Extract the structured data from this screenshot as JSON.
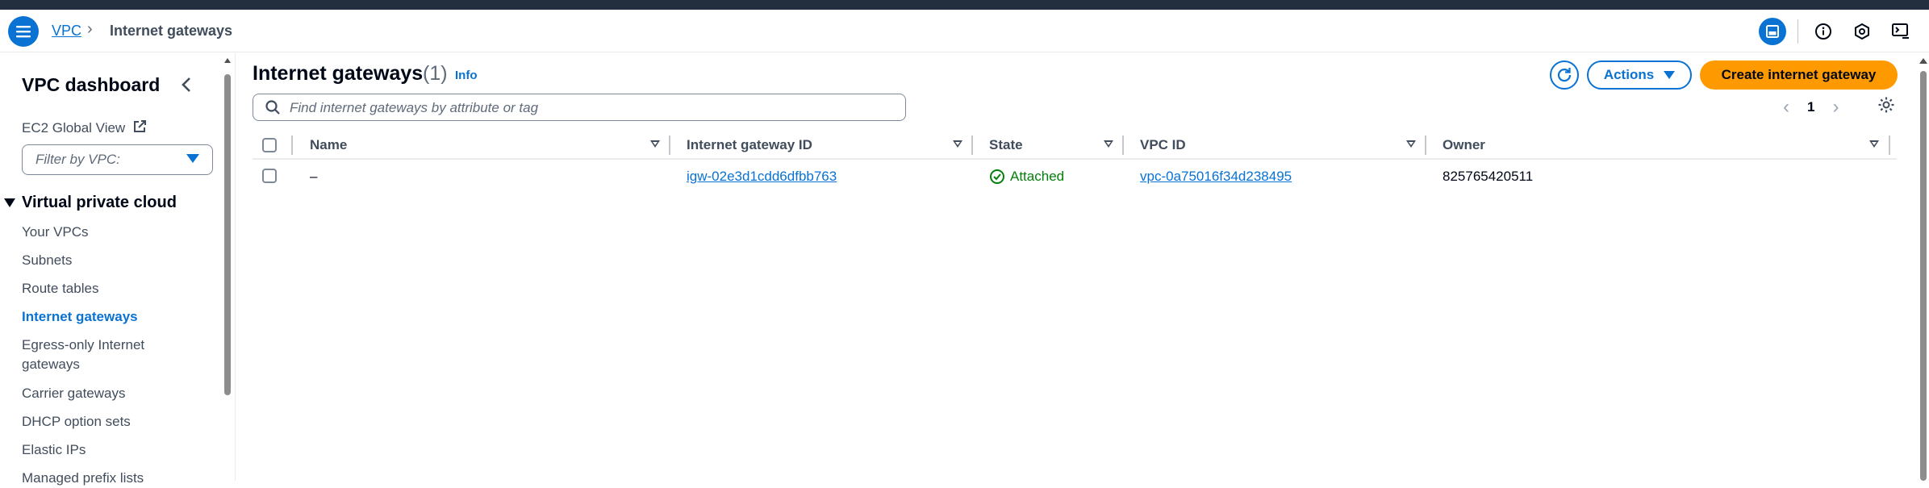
{
  "breadcrumb": {
    "root": "VPC",
    "separator": "›",
    "current": "Internet gateways"
  },
  "sidebar": {
    "title": "VPC dashboard",
    "ec2_global_view": "EC2 Global View",
    "filter_placeholder": "Filter by VPC:",
    "section": "Virtual private cloud",
    "items": [
      {
        "label": "Your VPCs"
      },
      {
        "label": "Subnets"
      },
      {
        "label": "Route tables"
      },
      {
        "label": "Internet gateways"
      },
      {
        "label": "Egress-only Internet gateways"
      },
      {
        "label": "Carrier gateways"
      },
      {
        "label": "DHCP option sets"
      },
      {
        "label": "Elastic IPs"
      },
      {
        "label": "Managed prefix lists"
      }
    ]
  },
  "main": {
    "title": "Internet gateways",
    "count": "(1)",
    "info": "Info",
    "actions_label": "Actions",
    "create_label": "Create internet gateway",
    "search_placeholder": "Find internet gateways by attribute or tag",
    "page": "1",
    "prev": "‹",
    "next": "›"
  },
  "table": {
    "columns": [
      "Name",
      "Internet gateway ID",
      "State",
      "VPC ID",
      "Owner"
    ],
    "rows": [
      {
        "name": "–",
        "igw_id": "igw-02e3d1cdd6dfbb763",
        "state": "Attached",
        "vpc_id": "vpc-0a75016f34d238495",
        "owner": "825765420511"
      }
    ]
  },
  "colors": {
    "accent": "#0972d3",
    "primary_button": "#ff9900",
    "success": "#037f0c",
    "topstrip": "#232f3e"
  },
  "icons": [
    "menu-icon",
    "external-link-icon",
    "refresh-icon",
    "search-icon",
    "settings-icon",
    "info-icon",
    "notifications-icon",
    "cloudshell-icon",
    "split-panel-icon",
    "check-circle-icon"
  ]
}
